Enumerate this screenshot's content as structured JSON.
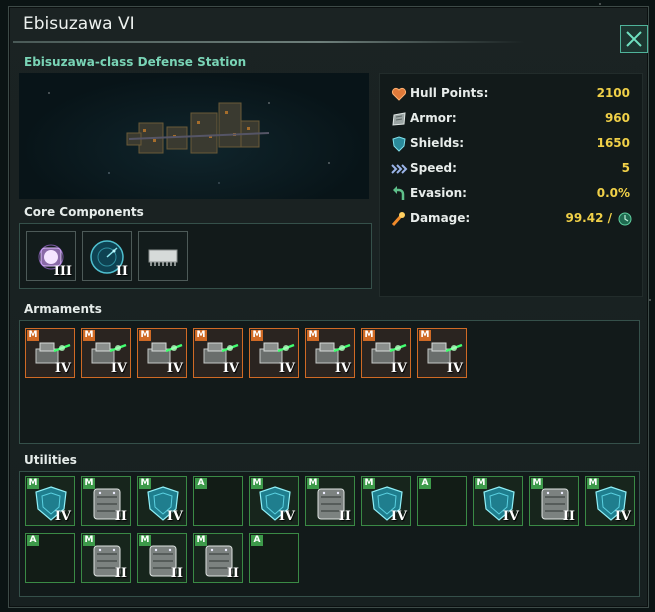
{
  "window": {
    "title": "Ebisuzawa VI",
    "subtitle": "Ebisuzawa-class Defense Station",
    "close_icon": "close-icon"
  },
  "stats": [
    {
      "label": "Hull Points:",
      "value": "2100",
      "icon": "heart-icon",
      "color": "#e07a3a"
    },
    {
      "label": "Armor:",
      "value": "960",
      "icon": "armor-plate-icon",
      "color": "#b9c1c0"
    },
    {
      "label": "Shields:",
      "value": "1650",
      "icon": "shield-icon",
      "color": "#3fb0c0"
    },
    {
      "label": "Speed:",
      "value": "5",
      "icon": "speed-arrows-icon",
      "color": "#8aa0d0"
    },
    {
      "label": "Evasion:",
      "value": "0.0%",
      "icon": "evasion-arrow-icon",
      "color": "#5fc08a"
    },
    {
      "label": "Damage:",
      "value": "99.42 /",
      "icon": "explosion-icon",
      "color": "#f08a2a"
    }
  ],
  "sections": {
    "core": "Core Components",
    "armaments": "Armaments",
    "utilities": "Utilities"
  },
  "core_components": [
    {
      "icon": "reactor-icon",
      "tier": "III"
    },
    {
      "icon": "sensor-radar-icon",
      "tier": "II"
    },
    {
      "icon": "computer-chip-icon",
      "tier": ""
    }
  ],
  "armaments": [
    {
      "tag": "M",
      "tier": "IV"
    },
    {
      "tag": "M",
      "tier": "IV"
    },
    {
      "tag": "M",
      "tier": "IV"
    },
    {
      "tag": "M",
      "tier": "IV"
    },
    {
      "tag": "M",
      "tier": "IV"
    },
    {
      "tag": "M",
      "tier": "IV"
    },
    {
      "tag": "M",
      "tier": "IV"
    },
    {
      "tag": "M",
      "tier": "IV"
    }
  ],
  "utilities": [
    {
      "tag": "M",
      "kind": "shield",
      "tier": "IV"
    },
    {
      "tag": "M",
      "kind": "armor",
      "tier": "II"
    },
    {
      "tag": "M",
      "kind": "shield",
      "tier": "IV"
    },
    {
      "tag": "A",
      "kind": "empty",
      "tier": ""
    },
    {
      "tag": "M",
      "kind": "shield",
      "tier": "IV"
    },
    {
      "tag": "M",
      "kind": "armor",
      "tier": "II"
    },
    {
      "tag": "M",
      "kind": "shield",
      "tier": "IV"
    },
    {
      "tag": "A",
      "kind": "empty",
      "tier": ""
    },
    {
      "tag": "M",
      "kind": "shield",
      "tier": "IV"
    },
    {
      "tag": "M",
      "kind": "armor",
      "tier": "II"
    },
    {
      "tag": "M",
      "kind": "shield",
      "tier": "IV"
    },
    {
      "tag": "A",
      "kind": "empty",
      "tier": ""
    },
    {
      "tag": "M",
      "kind": "armor",
      "tier": "II"
    },
    {
      "tag": "M",
      "kind": "armor",
      "tier": "II"
    },
    {
      "tag": "M",
      "kind": "armor",
      "tier": "II"
    },
    {
      "tag": "A",
      "kind": "empty",
      "tier": ""
    }
  ]
}
